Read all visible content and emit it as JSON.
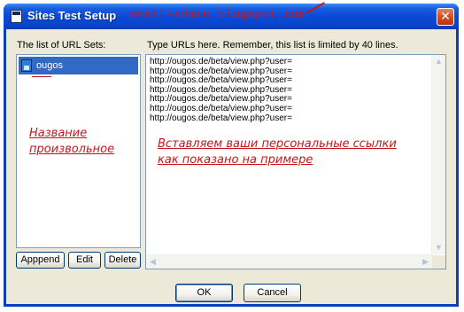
{
  "window": {
    "title": "Sites Test Setup",
    "watermark": "ersil-admin.blogspot.com",
    "close_label": "✕"
  },
  "left_panel": {
    "label": "The list of URL Sets:",
    "items": [
      {
        "label": "ougos",
        "selected": true
      }
    ],
    "annotation_line1": "Название",
    "annotation_line2": "произвольное"
  },
  "right_panel": {
    "label": "Type URLs here. Remember, this list is limited by 40 lines.",
    "lines": [
      "http://ougos.de/beta/view.php?user=",
      "http://ougos.de/beta/view.php?user=",
      "http://ougos.de/beta/view.php?user=",
      "http://ougos.de/beta/view.php?user=",
      "http://ougos.de/beta/view.php?user=",
      "http://ougos.de/beta/view.php?user=",
      "http://ougos.de/beta/view.php?user="
    ],
    "annotation_line1": "Вставляем ваши персональные ссылки",
    "annotation_line2": "как показано на примере"
  },
  "buttons": {
    "append": "Apppend",
    "edit": "Edit",
    "delete": "Delete",
    "ok": "OK",
    "cancel": "Cancel"
  },
  "colors": {
    "titlebar": "#0b4ad6",
    "selection": "#316ac5",
    "annotation": "#c8161c",
    "dialog_bg": "#ece9d8"
  }
}
